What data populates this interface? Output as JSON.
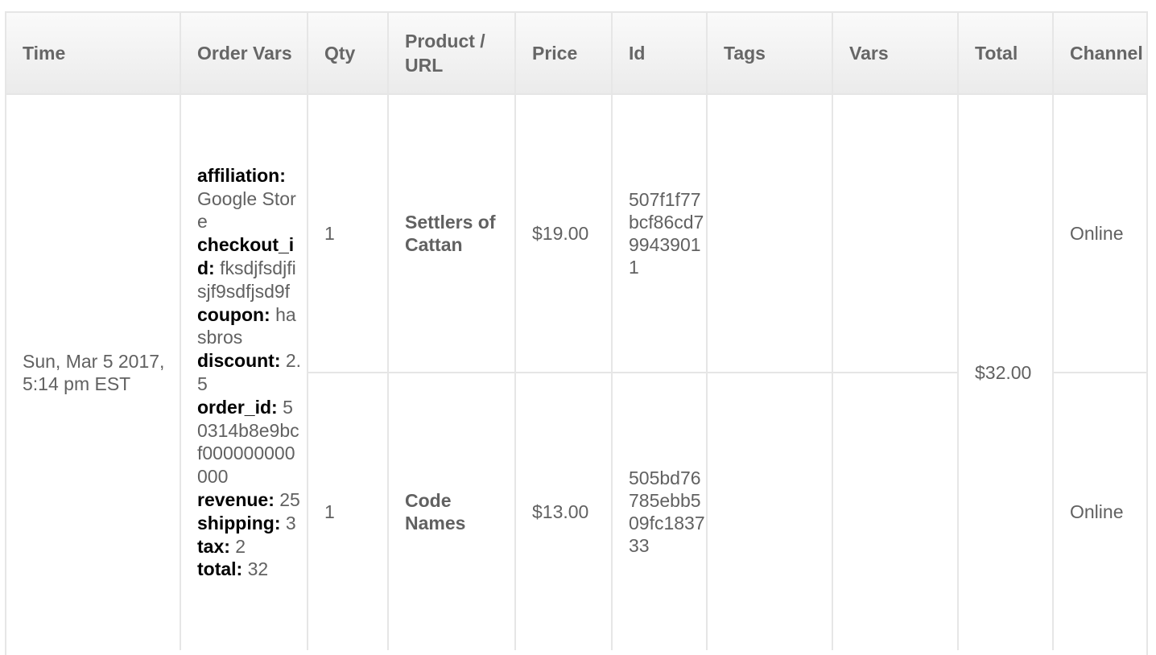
{
  "columns": [
    "Time",
    "Order Vars",
    "Qty",
    "Product / URL",
    "Price",
    "Id",
    "Tags",
    "Vars",
    "Total",
    "Channel"
  ],
  "order": {
    "time": "Sun, Mar 5 2017, 5:14 pm EST",
    "total": "$32.00",
    "order_vars": [
      {
        "key": "affiliation:",
        "value": "Google Store"
      },
      {
        "key": "checkout_id:",
        "value": "fksdjfsdjfisjf9sdfjsd9f"
      },
      {
        "key": "coupon:",
        "value": "hasbros"
      },
      {
        "key": "discount:",
        "value": "2.5"
      },
      {
        "key": "order_id:",
        "value": "50314b8e9bcf000000000000"
      },
      {
        "key": "revenue:",
        "value": "25"
      },
      {
        "key": "shipping:",
        "value": "3"
      },
      {
        "key": "tax:",
        "value": "2"
      },
      {
        "key": "total:",
        "value": "32"
      }
    ],
    "items": [
      {
        "qty": "1",
        "product": "Settlers of Cattan",
        "price": "$19.00",
        "id": "507f1f77bcf86cd799439011",
        "tags": "",
        "vars": "",
        "channel": "Online"
      },
      {
        "qty": "1",
        "product": "Code Names",
        "price": "$13.00",
        "id": "505bd76785ebb509fc183733",
        "tags": "",
        "vars": "",
        "channel": "Online"
      }
    ]
  }
}
